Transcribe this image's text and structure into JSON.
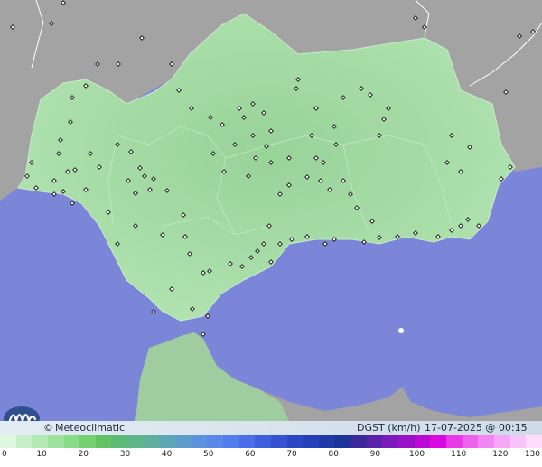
{
  "credit": {
    "symbol": "©",
    "text": "Meteoclimatic",
    "logo_icon": "meteoclimatic-logo-icon"
  },
  "map": {
    "variable_label": "DGST (km/h)",
    "timestamp": "17-07-2025 @ 00:15 UTC",
    "station_marker_icon": "station-diamond-icon"
  },
  "scale": {
    "ticks": [
      "0",
      "10",
      "20",
      "30",
      "40",
      "50",
      "60",
      "70",
      "80",
      "90",
      "100",
      "110",
      "120",
      "130"
    ],
    "colors": [
      "#dff7df",
      "#c8f0c8",
      "#b2eab2",
      "#9de39d",
      "#88dc88",
      "#73d173",
      "#63c263",
      "#5bbb73",
      "#5db58a",
      "#5fae9e",
      "#5fa6b3",
      "#5e9ccc",
      "#5d92de",
      "#5a88e8",
      "#537ded",
      "#4a6fe8",
      "#3f60dd",
      "#3552d1",
      "#2b46c4",
      "#2340b8",
      "#1f3aa8",
      "#1b3498",
      "#3a2a9a",
      "#5a22a8",
      "#7a1ab8",
      "#9a12c8",
      "#bb0ad6",
      "#d80ae0",
      "#e63ae6",
      "#ec62ec",
      "#f286f2",
      "#f6a6f6",
      "#f9c4f9",
      "#fcdefc"
    ]
  },
  "colors": {
    "sea": "#7b86d9",
    "land_green": "#a7dca7",
    "land_gray": "#9e9e9e"
  }
}
